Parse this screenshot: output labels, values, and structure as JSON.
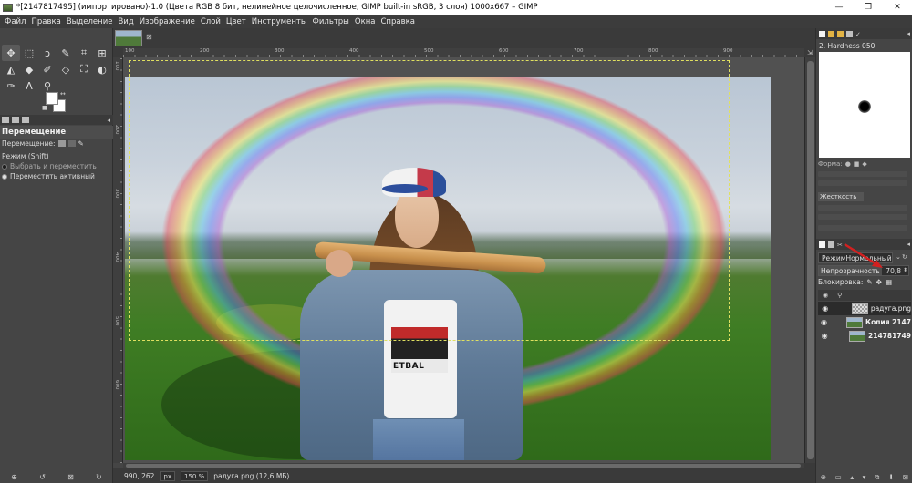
{
  "window": {
    "title": "*[2147817495] (импортировано)-1.0 (Цвета RGB 8 бит, нелинейное целочисленное, GIMP built-in sRGB, 3 слоя) 1000x667 – GIMP",
    "minimize": "—",
    "maximize": "❐",
    "close": "✕"
  },
  "menu": [
    "Файл",
    "Правка",
    "Выделение",
    "Вид",
    "Изображение",
    "Слой",
    "Цвет",
    "Инструменты",
    "Фильтры",
    "Окна",
    "Справка"
  ],
  "toolbox": {
    "tools": [
      {
        "name": "move-tool-icon",
        "glyph": "✥"
      },
      {
        "name": "rect-select-icon",
        "glyph": "⬚"
      },
      {
        "name": "lasso-icon",
        "glyph": "ↄ"
      },
      {
        "name": "fuzzy-select-icon",
        "glyph": "✎"
      },
      {
        "name": "crop-icon",
        "glyph": "⌗"
      },
      {
        "name": "transform-icon",
        "glyph": "⊞"
      },
      {
        "name": "warp-icon",
        "glyph": "◭"
      },
      {
        "name": "bucket-fill-icon",
        "glyph": "◆"
      },
      {
        "name": "paintbrush-icon",
        "glyph": "✐"
      },
      {
        "name": "eraser-icon",
        "glyph": "◇"
      },
      {
        "name": "clone-icon",
        "glyph": "⛶"
      },
      {
        "name": "smudge-icon",
        "glyph": "◐"
      },
      {
        "name": "paths-icon",
        "glyph": "✑"
      },
      {
        "name": "text-tool-icon",
        "glyph": "A"
      },
      {
        "name": "zoom-tool-icon",
        "glyph": "⚲"
      }
    ],
    "options_title": "Перемещение",
    "move_label": "Перемещение:",
    "mode_label": "Режим (Shift)",
    "opt1": "Выбрать и переместить",
    "opt2": "Переместить активный",
    "bottom": [
      "⊕",
      "↺",
      "⊠",
      "↻"
    ]
  },
  "ruler": {
    "top": [
      "100",
      "200",
      "300",
      "400",
      "500",
      "600",
      "700",
      "800",
      "900"
    ],
    "left": [
      "100",
      "200",
      "300",
      "400",
      "500",
      "600"
    ]
  },
  "image": {
    "shirt_text": "ETBAL"
  },
  "statusbar": {
    "coords": "990, 262",
    "unit": "px",
    "zoom": "150 %",
    "info": "радуга.png (12,6 МБ)"
  },
  "dock": {
    "brush_name": "2. Hardness 050",
    "form_label": "Форма:",
    "hardness_label": "Жесткость",
    "mode_prefix": "Режим",
    "mode_value": "Нормальный",
    "opacity_label": "Непрозрачность",
    "opacity_value": "70,8",
    "opacity_percent": 70.8,
    "lock_label": "Блокировка:",
    "layers": [
      {
        "name": "радуга.png",
        "bold": false,
        "thumb": "check",
        "active": true
      },
      {
        "name": "Копия 2147",
        "bold": true,
        "thumb": "pic",
        "active": false
      },
      {
        "name": "214781749",
        "bold": true,
        "thumb": "pic",
        "active": false
      }
    ],
    "bottom": [
      "⊕",
      "▭",
      "▴",
      "▾",
      "⧉",
      "⬇",
      "⊠"
    ]
  },
  "colors": {
    "accent_arrow": "#d32020",
    "bg": "#454545"
  }
}
